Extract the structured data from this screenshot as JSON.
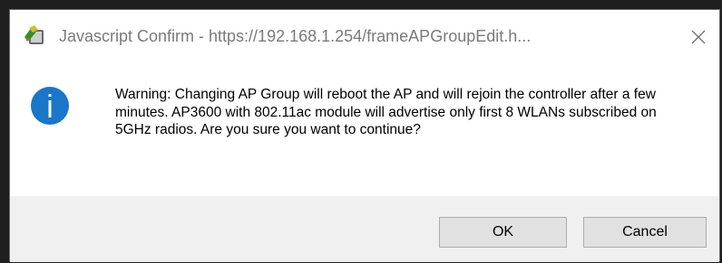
{
  "window": {
    "title": "Javascript Confirm - https://192.168.1.254/frameAPGroupEdit.h...",
    "title_icon": "java-applet-icon",
    "close_icon": "close-icon"
  },
  "dialog": {
    "message": "Warning: Changing AP Group will reboot the AP and will rejoin the controller after a few minutes. AP3600 with 802.11ac module will advertise only first 8 WLANs subscribed on 5GHz radios. Are you sure you want to continue?",
    "icon": "information-icon"
  },
  "buttons": {
    "ok_label": "OK",
    "cancel_label": "Cancel"
  },
  "colors": {
    "info_blue": "#1a76c9",
    "title_gray": "#7a7a7a",
    "dialog_bg": "#f0f0f0",
    "button_bg": "#e1e1e1"
  }
}
